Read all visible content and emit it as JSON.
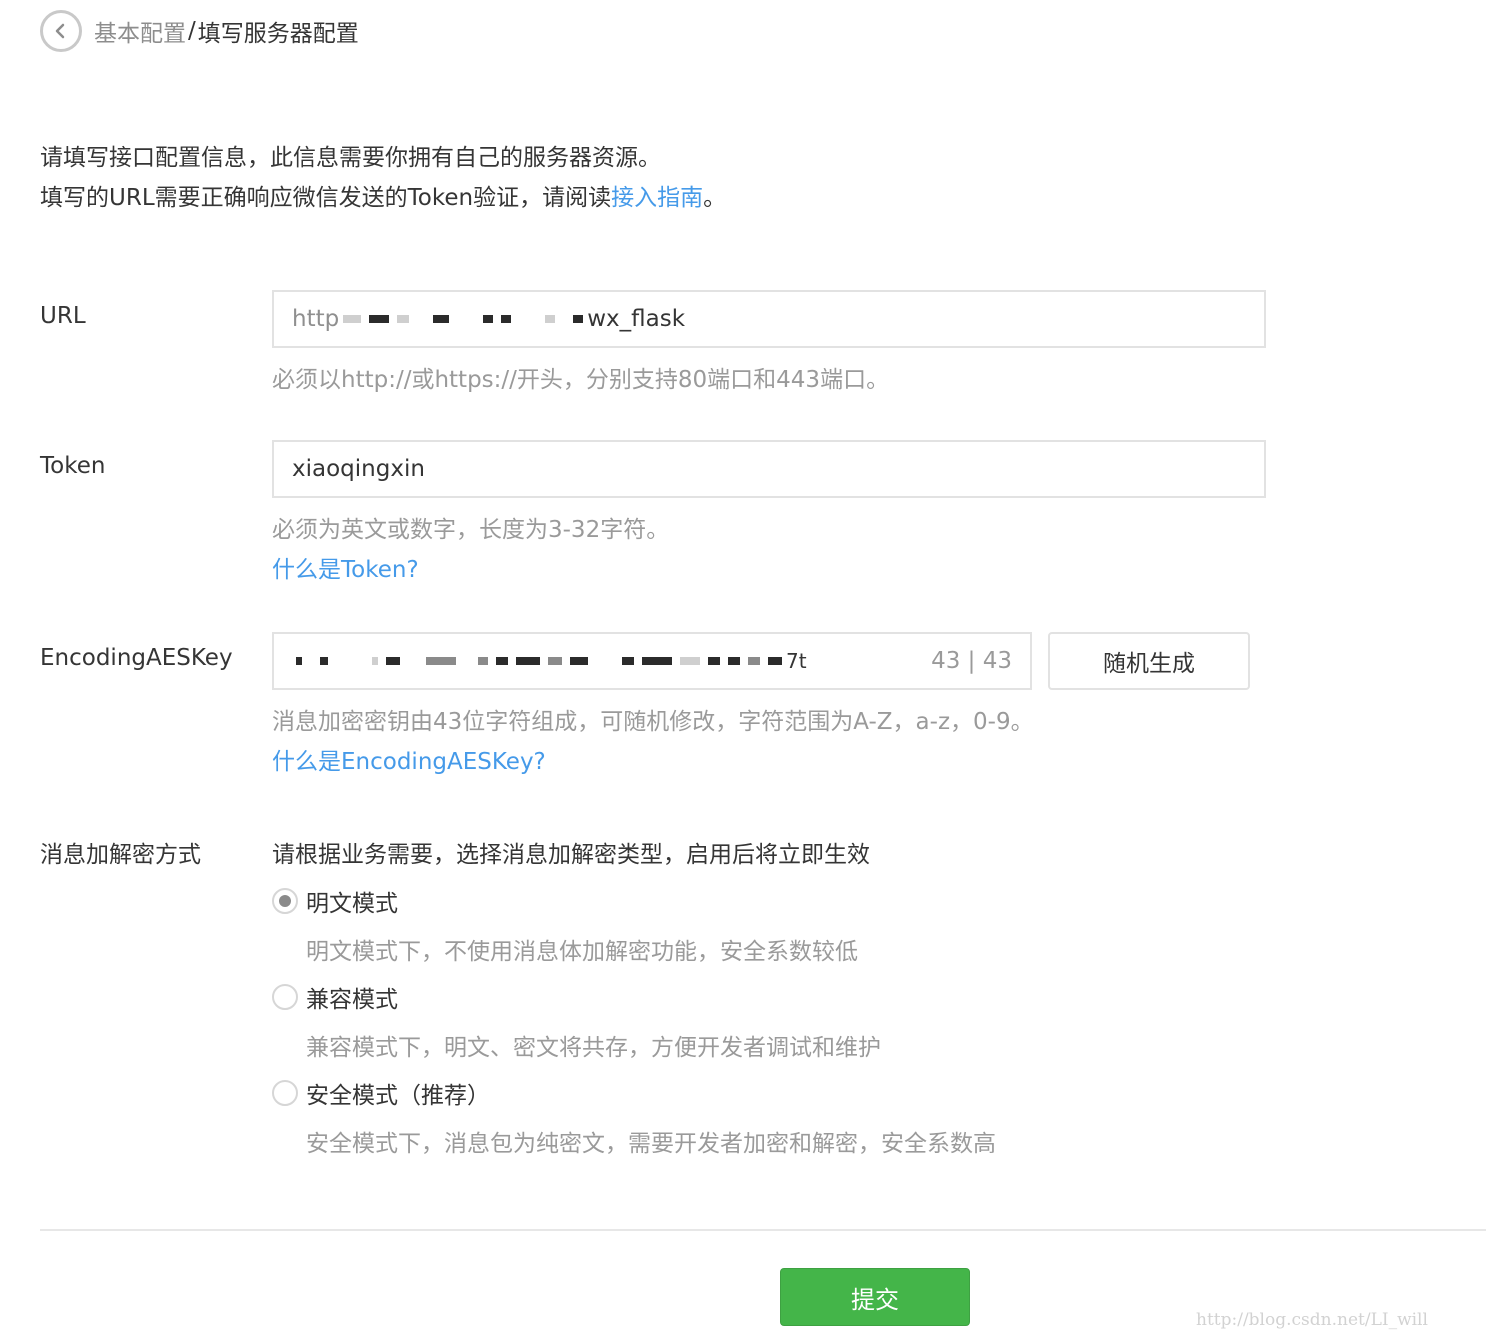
{
  "breadcrumb": {
    "parent": "基本配置",
    "separator": "/",
    "current": " 填写服务器配置"
  },
  "intro": {
    "line1": "请填写接口配置信息，此信息需要你拥有自己的服务器资源。",
    "line2_prefix": "填写的URL需要正确响应微信发送的Token验证，请阅读",
    "line2_link": "接入指南",
    "line2_suffix": "。"
  },
  "url_field": {
    "label": "URL",
    "value_visible_prefix": "http",
    "value_visible_suffix": "wx_flask",
    "hint": "必须以http://或https://开头，分别支持80端口和443端口。"
  },
  "token_field": {
    "label": "Token",
    "value": "xiaoqingxin",
    "hint": "必须为英文或数字，长度为3-32字符。",
    "help_link": "什么是Token?"
  },
  "aeskey_field": {
    "label": "EncodingAESKey",
    "value_visible_suffix": "7t",
    "counter": "43 | 43",
    "random_button": "随机生成",
    "hint": "消息加密密钥由43位字符组成，可随机修改，字符范围为A-Z，a-z，0-9。",
    "help_link": "什么是EncodingAESKey?"
  },
  "encryption": {
    "label": "消息加解密方式",
    "description": "请根据业务需要，选择消息加解密类型，启用后将立即生效",
    "options": [
      {
        "label": "明文模式",
        "desc": "明文模式下，不使用消息体加解密功能，安全系数较低",
        "selected": true
      },
      {
        "label": "兼容模式",
        "desc": "兼容模式下，明文、密文将共存，方便开发者调试和维护",
        "selected": false
      },
      {
        "label": "安全模式（推荐）",
        "desc": "安全模式下，消息包为纯密文，需要开发者加密和解密，安全系数高",
        "selected": false
      }
    ]
  },
  "submit_button": "提交",
  "watermark": "http://blog.csdn.net/LI_will",
  "colors": {
    "link": "#459ae9",
    "primary_button": "#44b549",
    "hint_text": "#9a9a9a",
    "border": "#e2e2e2"
  }
}
